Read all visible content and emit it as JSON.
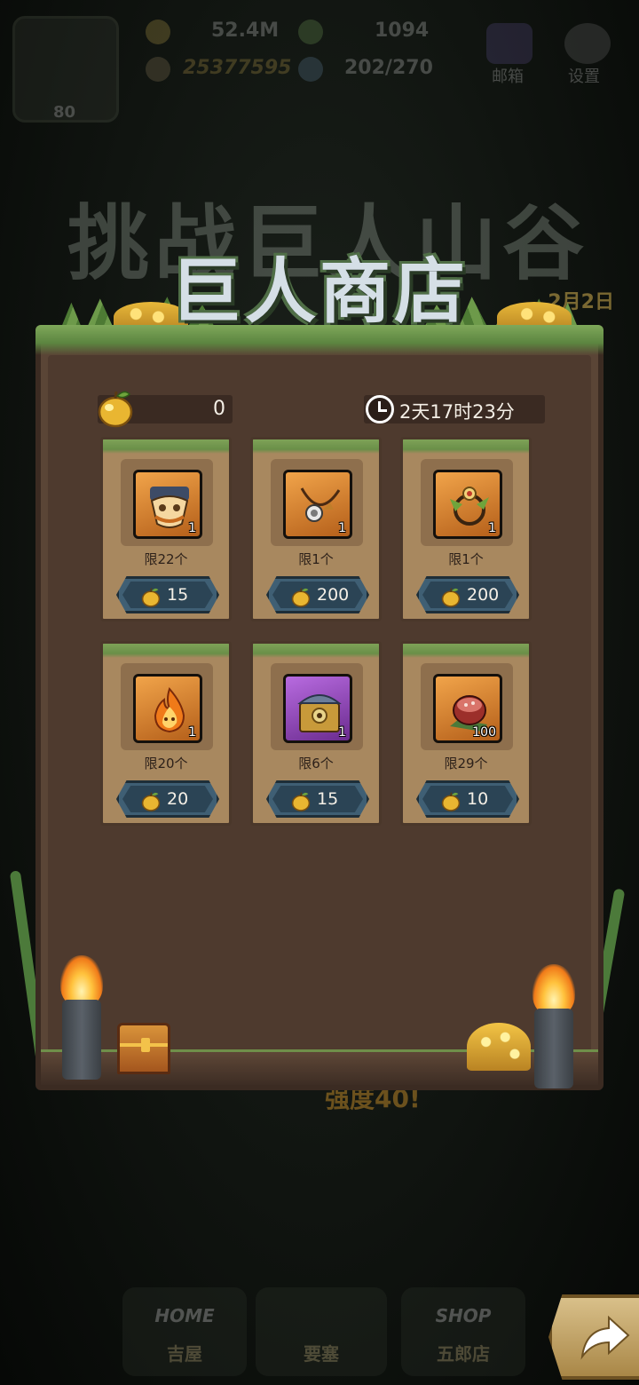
{
  "background_hud": {
    "level": "80",
    "coins": "52.4M",
    "gems": "1094",
    "power": "25377595",
    "energy": "202/270",
    "mail_label": "邮箱",
    "settings_label": "设置",
    "event_title": "挑战巨人山谷",
    "event_date": "2月2日",
    "strength_text": "强度40!"
  },
  "shop": {
    "title": "巨人商店",
    "currency_value": "0",
    "timer": "2天17时23分",
    "items": [
      {
        "icon": "mask-icon",
        "count": "1",
        "limit": "限22个",
        "price": "15",
        "rarity": "orange"
      },
      {
        "icon": "necklace-icon",
        "count": "1",
        "limit": "限1个",
        "price": "200",
        "rarity": "orange"
      },
      {
        "icon": "amulet-icon",
        "count": "1",
        "limit": "限1个",
        "price": "200",
        "rarity": "orange"
      },
      {
        "icon": "fire-spirit-icon",
        "count": "1",
        "limit": "限20个",
        "price": "20",
        "rarity": "orange"
      },
      {
        "icon": "treasure-chest-icon",
        "count": "1",
        "limit": "限6个",
        "price": "15",
        "rarity": "purple"
      },
      {
        "icon": "meat-icon",
        "count": "100",
        "limit": "限29个",
        "price": "10",
        "rarity": "orange"
      }
    ]
  },
  "bottom_nav": {
    "home_sub": "HOME",
    "home_label": "吉屋",
    "fortress_label": "要塞",
    "shop_sub": "SHOP",
    "shop_label": "五郎店"
  },
  "colors": {
    "panel": "#5a4536",
    "card": "#a8885f",
    "price_button": "#3f5f74",
    "moss": "#7ea257"
  }
}
